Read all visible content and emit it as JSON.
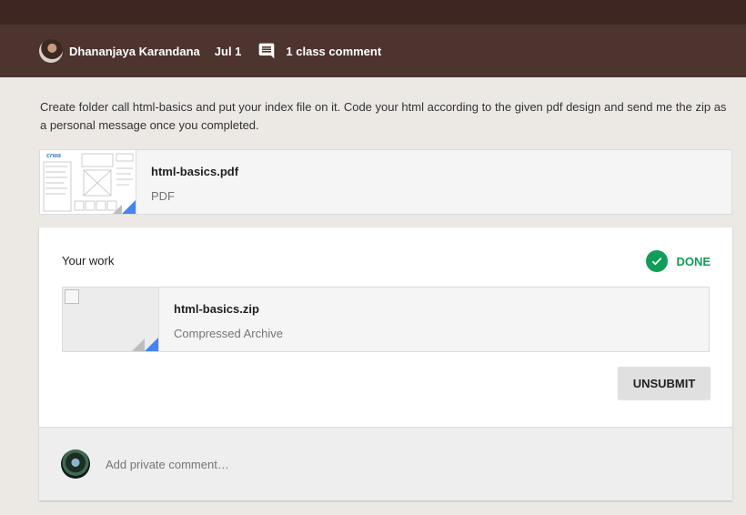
{
  "header": {
    "author": "Dhananjaya Karandana",
    "date": "Jul 1",
    "comment_count": "1 class comment"
  },
  "description": "Create folder call html-basics and put your index file on it. Code your html according to the given pdf design and send me the zip as a personal message once you completed.",
  "attachment": {
    "name": "html-basics.pdf",
    "type": "PDF",
    "thumb_brand": "crwa"
  },
  "your_work": {
    "title": "Your work",
    "status": "DONE",
    "file": {
      "name": "html-basics.zip",
      "type": "Compressed Archive"
    },
    "unsubmit_label": "UNSUBMIT"
  },
  "private_comment": {
    "placeholder": "Add private comment…"
  },
  "colors": {
    "header_bg": "#4e342e",
    "top_strip": "#3e2723",
    "page_bg": "#ece9e5",
    "done_green": "#0f9d58",
    "fold_blue": "#4285f4"
  },
  "icons": [
    "comment-icon",
    "check-icon"
  ]
}
